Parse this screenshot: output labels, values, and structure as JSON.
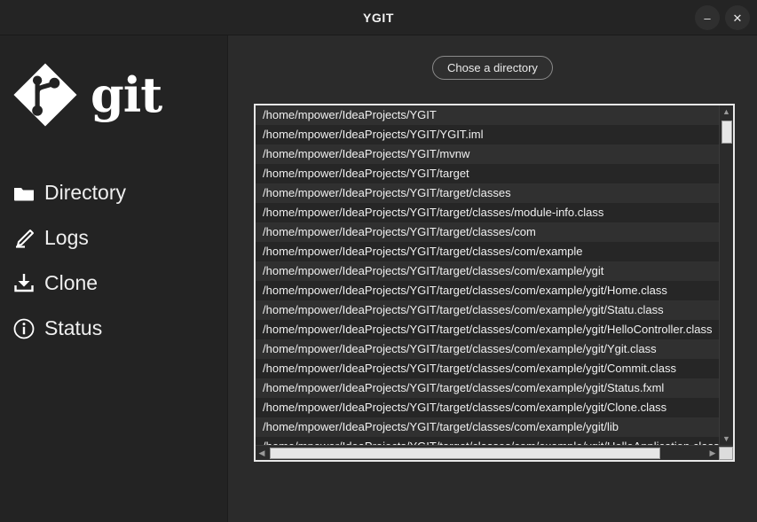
{
  "window": {
    "title": "YGIT",
    "minimize_label": "–",
    "close_label": "✕"
  },
  "sidebar": {
    "brand": {
      "logo_icon": "git-logo-icon",
      "text": "git"
    },
    "items": [
      {
        "label": "Directory",
        "icon": "folder-icon"
      },
      {
        "label": "Logs",
        "icon": "pencil-icon"
      },
      {
        "label": "Clone",
        "icon": "download-icon"
      },
      {
        "label": "Status",
        "icon": "info-circle-icon"
      }
    ]
  },
  "main": {
    "choose_directory_button": "Chose a directory",
    "file_list": [
      "/home/mpower/IdeaProjects/YGIT",
      "/home/mpower/IdeaProjects/YGIT/YGIT.iml",
      "/home/mpower/IdeaProjects/YGIT/mvnw",
      "/home/mpower/IdeaProjects/YGIT/target",
      "/home/mpower/IdeaProjects/YGIT/target/classes",
      "/home/mpower/IdeaProjects/YGIT/target/classes/module-info.class",
      "/home/mpower/IdeaProjects/YGIT/target/classes/com",
      "/home/mpower/IdeaProjects/YGIT/target/classes/com/example",
      "/home/mpower/IdeaProjects/YGIT/target/classes/com/example/ygit",
      "/home/mpower/IdeaProjects/YGIT/target/classes/com/example/ygit/Home.class",
      "/home/mpower/IdeaProjects/YGIT/target/classes/com/example/ygit/Statu.class",
      "/home/mpower/IdeaProjects/YGIT/target/classes/com/example/ygit/HelloController.class",
      "/home/mpower/IdeaProjects/YGIT/target/classes/com/example/ygit/Ygit.class",
      "/home/mpower/IdeaProjects/YGIT/target/classes/com/example/ygit/Commit.class",
      "/home/mpower/IdeaProjects/YGIT/target/classes/com/example/ygit/Status.fxml",
      "/home/mpower/IdeaProjects/YGIT/target/classes/com/example/ygit/Clone.class",
      "/home/mpower/IdeaProjects/YGIT/target/classes/com/example/ygit/lib",
      "/home/mpower/IdeaProjects/YGIT/target/classes/com/example/ygit/HelloApplication.class"
    ],
    "scrollbar": {
      "up_arrow": "▲",
      "down_arrow": "▼",
      "left_arrow": "◀",
      "right_arrow": "▶"
    }
  },
  "colors": {
    "window_bg": "#2b2b2b",
    "sidebar_bg": "#232323",
    "titlebar_bg": "#242424",
    "text": "#f0f0f0",
    "panel_border": "#e8e8e8"
  }
}
